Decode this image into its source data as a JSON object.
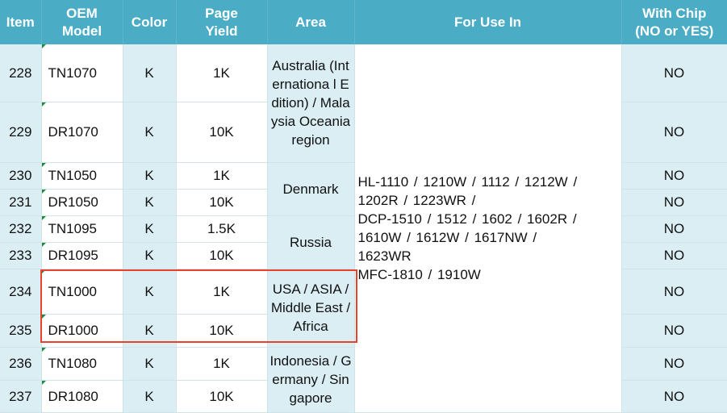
{
  "header": {
    "item": "Item",
    "oem_model": [
      "OEM",
      "Model"
    ],
    "color": "Color",
    "page_yield": [
      "Page",
      "Yield"
    ],
    "area": "Area",
    "for_use_in": "For Use In",
    "with_chip": [
      "With Chip",
      "(NO or YES)"
    ]
  },
  "rows": [
    {
      "item": "228",
      "model": "TN1070",
      "color": "K",
      "yield": "1K",
      "chip": "NO"
    },
    {
      "item": "229",
      "model": "DR1070",
      "color": "K",
      "yield": "10K",
      "chip": "NO"
    },
    {
      "item": "230",
      "model": "TN1050",
      "color": "K",
      "yield": "1K",
      "chip": "NO"
    },
    {
      "item": "231",
      "model": "DR1050",
      "color": "K",
      "yield": "10K",
      "chip": "NO"
    },
    {
      "item": "232",
      "model": "TN1095",
      "color": "K",
      "yield": "1.5K",
      "chip": "NO"
    },
    {
      "item": "233",
      "model": "DR1095",
      "color": "K",
      "yield": "10K",
      "chip": "NO"
    },
    {
      "item": "234",
      "model": "TN1000",
      "color": "K",
      "yield": "1K",
      "chip": "NO"
    },
    {
      "item": "235",
      "model": "DR1000",
      "color": "K",
      "yield": "10K",
      "chip": "NO"
    },
    {
      "item": "236",
      "model": "TN1080",
      "color": "K",
      "yield": "1K",
      "chip": "NO"
    },
    {
      "item": "237",
      "model": "DR1080",
      "color": "K",
      "yield": "10K",
      "chip": "NO"
    }
  ],
  "areas": [
    "Australia (Internationa l Edition) / Malaysia Oceania region",
    "Denmark",
    "Russia",
    "USA / ASIA / Middle East / Africa",
    "Indonesia / Germany / Singapore"
  ],
  "for_use_in": [
    "HL-1110 / 1210W / 1112 / 1212W /",
    "1202R / 1223WR /",
    "DCP-1510 / 1512 / 1602 / 1602R /",
    "1610W / 1612W / 1617NW /",
    "1623WR",
    "MFC-1810 / 1910W"
  ],
  "colors": {
    "header_bg": "#4bacc6",
    "band_bg": "#daeef3",
    "highlight_border": "#e8412c"
  }
}
